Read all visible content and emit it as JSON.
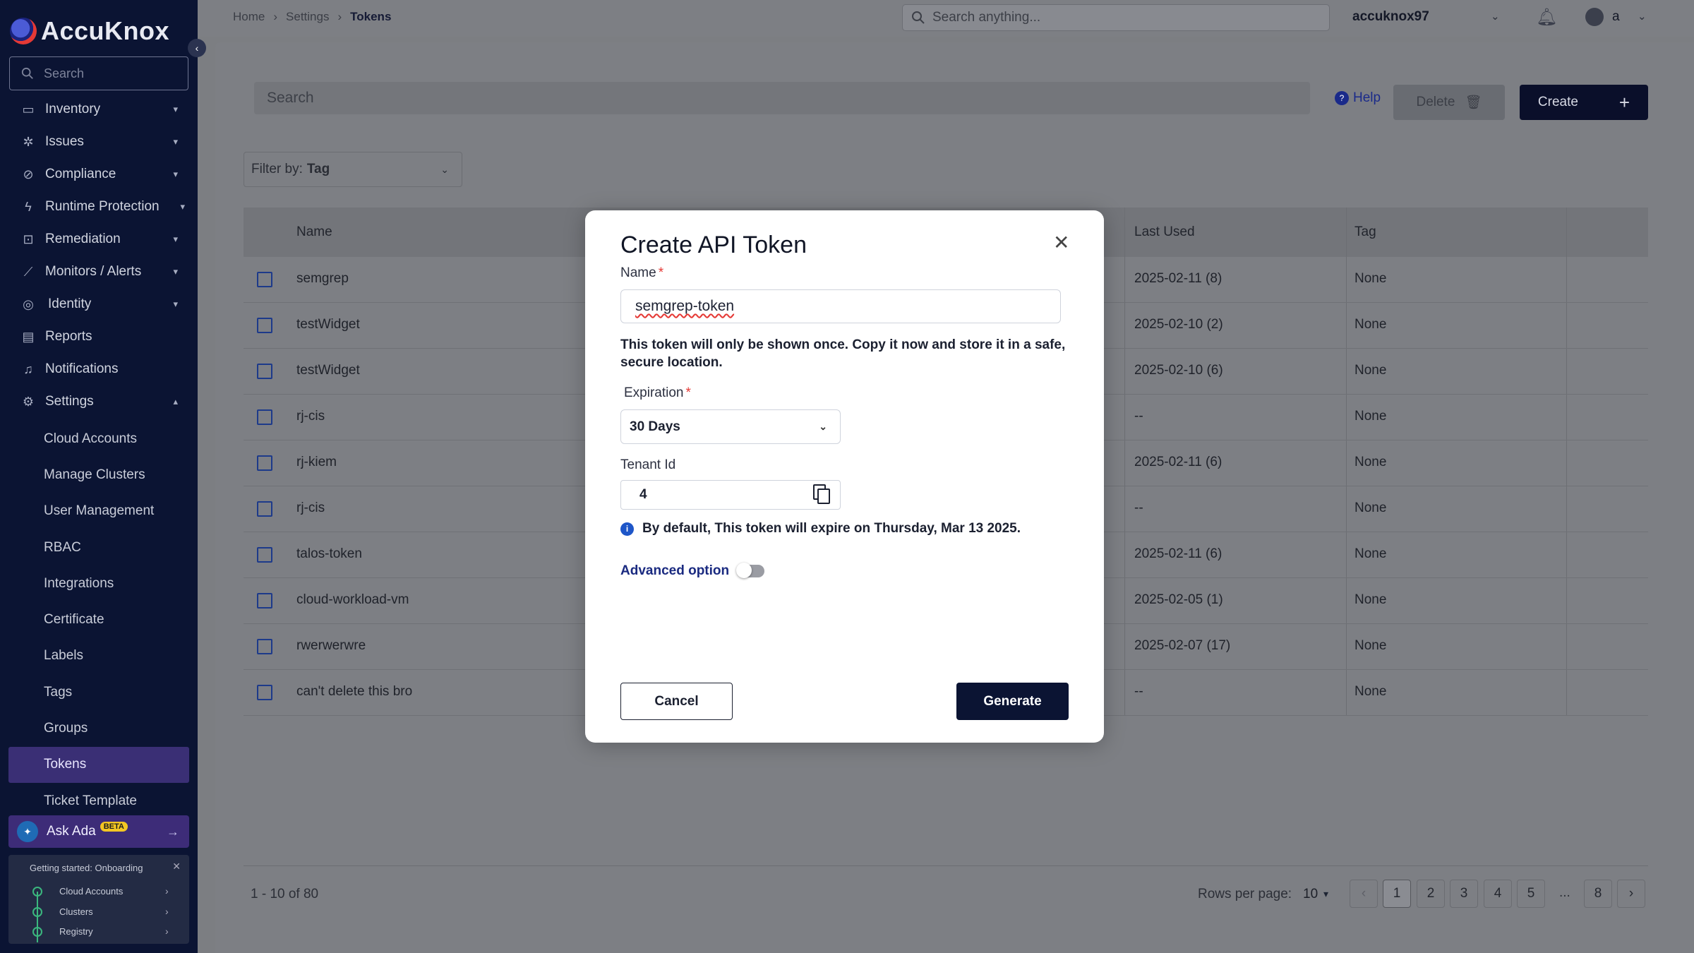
{
  "brand": {
    "name": "AccuKnox"
  },
  "sidebar": {
    "search_placeholder": "Search",
    "items": [
      {
        "label": "Inventory",
        "icon": "inventory-icon",
        "expandable": true
      },
      {
        "label": "Issues",
        "icon": "bug-icon",
        "expandable": true
      },
      {
        "label": "Compliance",
        "icon": "compliance-icon",
        "expandable": true
      },
      {
        "label": "Runtime Protection",
        "icon": "lightning-icon",
        "expandable": true
      },
      {
        "label": "Remediation",
        "icon": "remediation-icon",
        "expandable": true
      },
      {
        "label": "Monitors / Alerts",
        "icon": "chart-line-icon",
        "expandable": true
      },
      {
        "label": "Identity",
        "icon": "fingerprint-icon",
        "expandable": true
      },
      {
        "label": "Reports",
        "icon": "report-icon",
        "expandable": false
      },
      {
        "label": "Notifications",
        "icon": "bell-icon",
        "expandable": false
      },
      {
        "label": "Settings",
        "icon": "gear-icon",
        "expandable": true
      }
    ],
    "settings_sub": [
      "Cloud Accounts",
      "Manage Clusters",
      "User Management",
      "RBAC",
      "Integrations",
      "Certificate",
      "Labels",
      "Tags",
      "Groups",
      "Tokens",
      "Ticket Template"
    ],
    "active_sub": "Tokens",
    "ask_ada": {
      "label": "Ask Ada",
      "badge": "BETA"
    },
    "onboarding": {
      "title": "Getting started: Onboarding",
      "steps": [
        "Cloud Accounts",
        "Clusters",
        "Registry"
      ]
    }
  },
  "topbar": {
    "breadcrumbs": [
      "Home",
      "Settings",
      "Tokens"
    ],
    "search_placeholder": "Search anything...",
    "tenant": "accuknox97",
    "user": "a"
  },
  "toolbar": {
    "search_placeholder": "Search",
    "help": "Help",
    "delete": "Delete",
    "create": "Create",
    "filter_prefix": "Filter by:",
    "filter_value": "Tag"
  },
  "table": {
    "headers": {
      "name": "Name",
      "last_used": "Last Used",
      "tag": "Tag"
    },
    "rows": [
      {
        "name": "semgrep",
        "last_used": "2025-02-11 (8)",
        "tag": "None"
      },
      {
        "name": "testWidget",
        "last_used": "2025-02-10 (2)",
        "tag": "None"
      },
      {
        "name": "testWidget",
        "last_used": "2025-02-10 (6)",
        "tag": "None"
      },
      {
        "name": "rj-cis",
        "last_used": "--",
        "tag": "None"
      },
      {
        "name": "rj-kiem",
        "last_used": "2025-02-11 (6)",
        "tag": "None"
      },
      {
        "name": "rj-cis",
        "last_used": "--",
        "tag": "None"
      },
      {
        "name": "talos-token",
        "last_used": "2025-02-11 (6)",
        "tag": "None"
      },
      {
        "name": "cloud-workload-vm",
        "last_used": "2025-02-05 (1)",
        "tag": "None"
      },
      {
        "name": "rwerwerwre",
        "last_used": "2025-02-07 (17)",
        "tag": "None"
      },
      {
        "name": "can't delete this bro",
        "last_used": "--",
        "tag": "None"
      }
    ]
  },
  "pagination": {
    "range_text": "1 - 10 of 80",
    "rows_per_page_label": "Rows per page:",
    "rows_per_page": "10",
    "pages": [
      "1",
      "2",
      "3",
      "4",
      "5"
    ],
    "ellipsis": "...",
    "last_page": "8",
    "current": "1"
  },
  "modal": {
    "title": "Create API Token",
    "name_label": "Name",
    "name_value": "semgrep-token",
    "note": "This token will only be shown once. Copy it now and store it in a safe, secure location.",
    "expiration_label": "Expiration",
    "expiration_value": "30 Days",
    "tenant_label": "Tenant Id",
    "tenant_value": "4",
    "info": "By default, This token will expire on Thursday, Mar 13 2025.",
    "advanced_label": "Advanced option",
    "advanced_enabled": false,
    "cancel": "Cancel",
    "generate": "Generate"
  },
  "colors": {
    "sidebar_bg": "#0b1433",
    "active_item": "#3a2f75",
    "primary_button": "#0b1433",
    "required": "#e53935",
    "link": "#1a2a80"
  }
}
